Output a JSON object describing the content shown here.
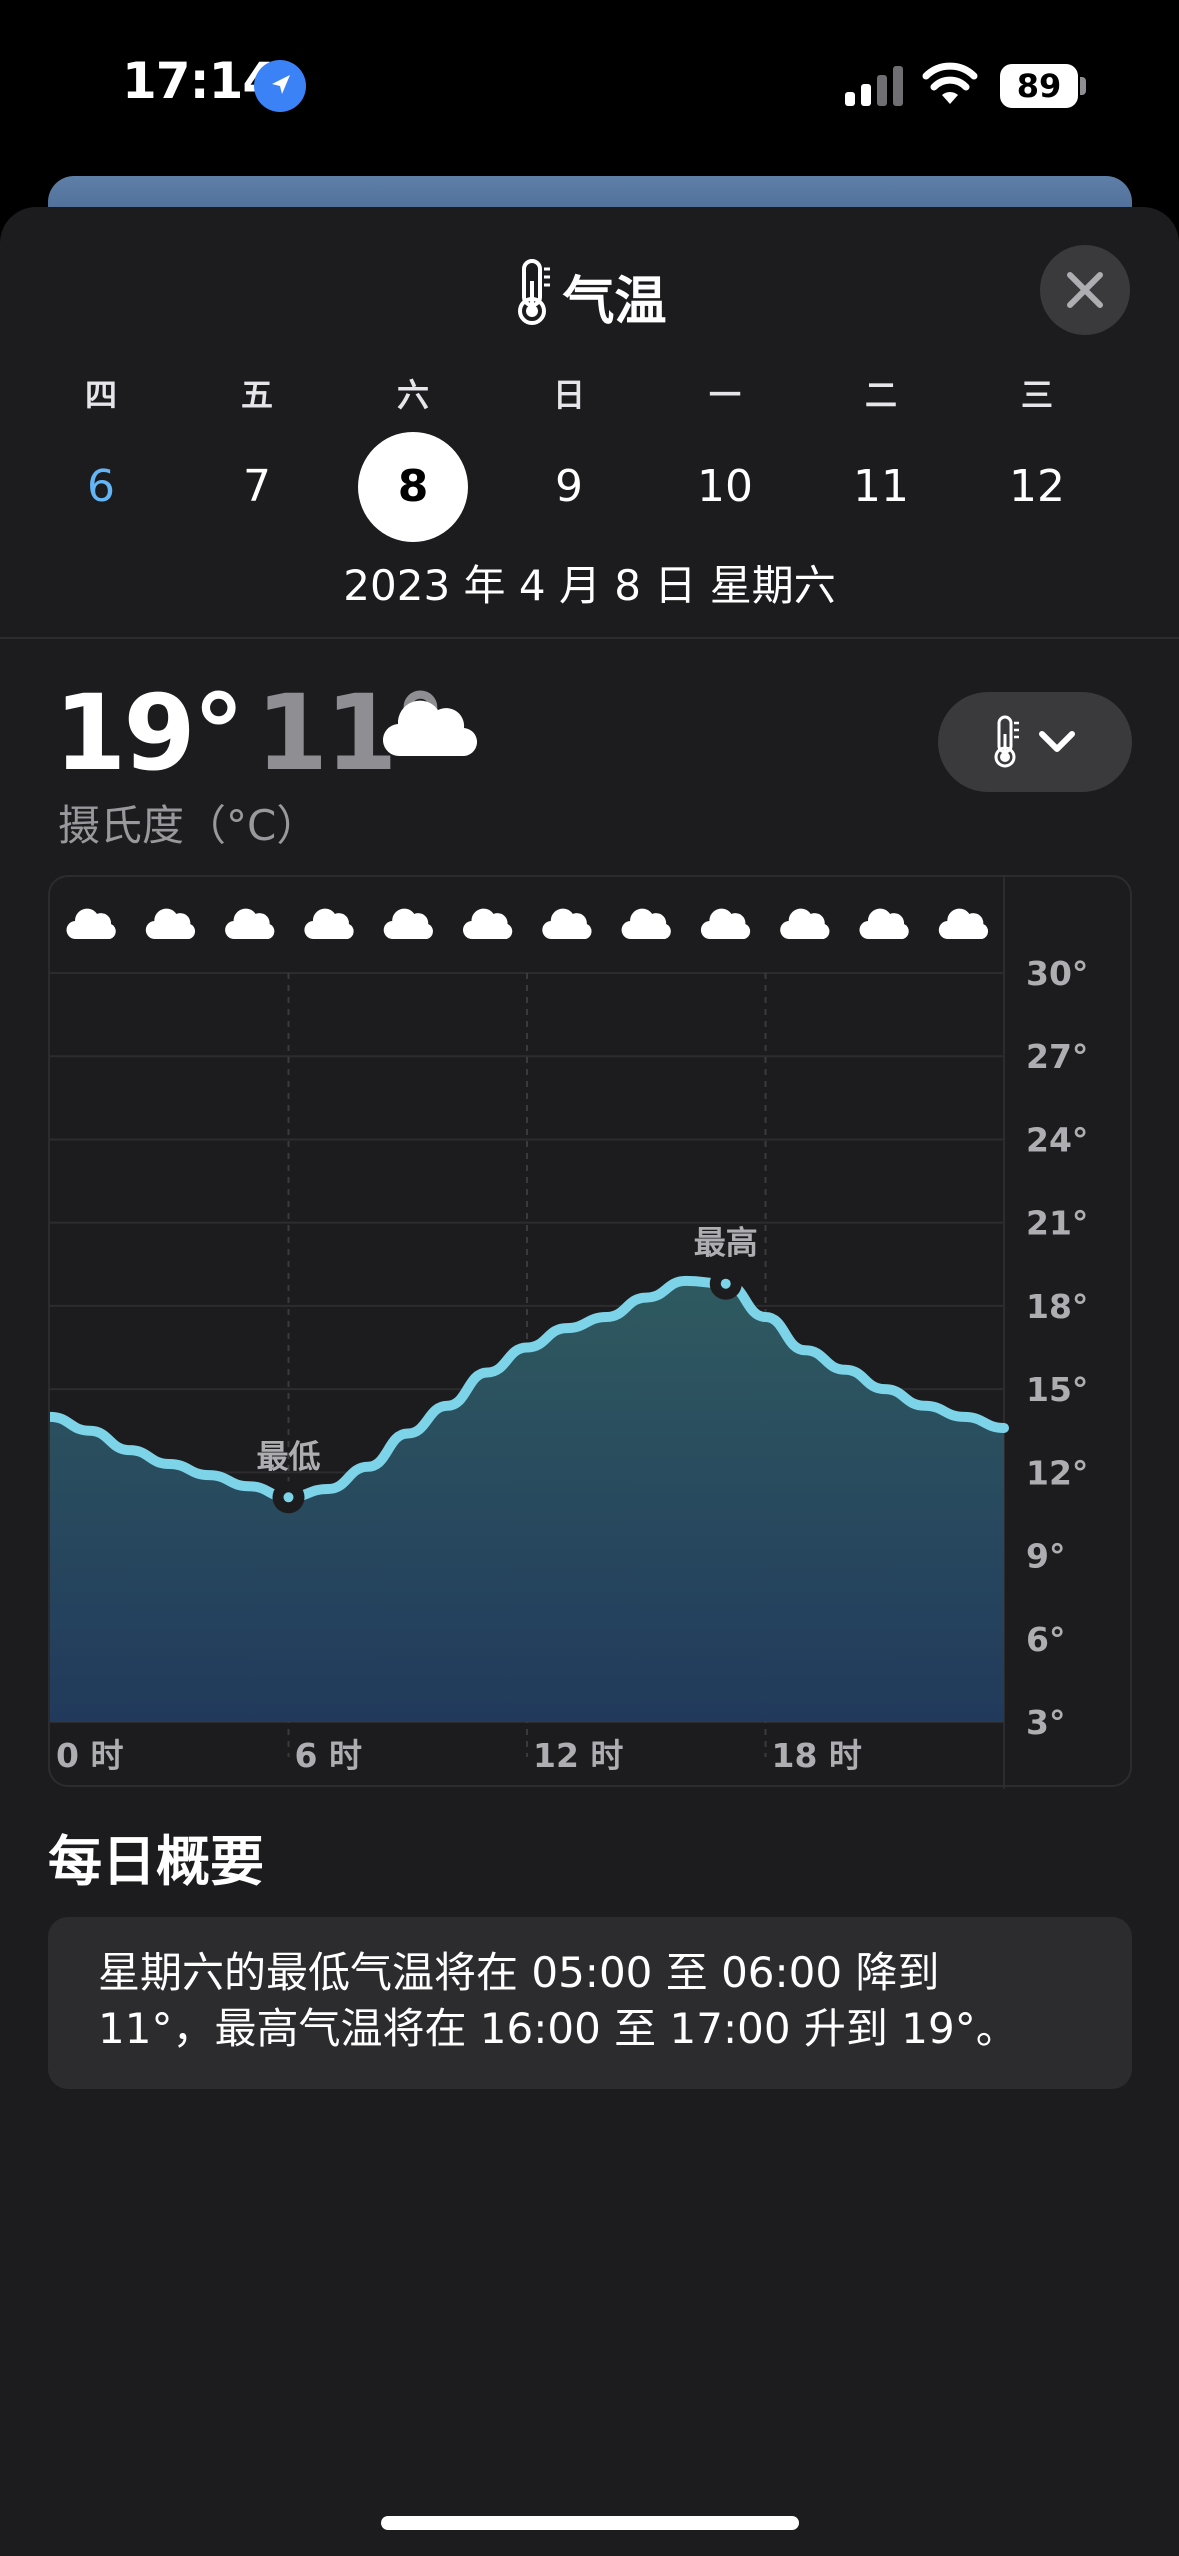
{
  "status_bar": {
    "time": "17:14",
    "battery": "89"
  },
  "sheet": {
    "title": "气温",
    "weekdays": [
      "四",
      "五",
      "六",
      "日",
      "一",
      "二",
      "三"
    ],
    "dates": [
      "6",
      "7",
      "8",
      "9",
      "10",
      "11",
      "12"
    ],
    "selected_date": "8",
    "today_date": "6",
    "full_date": "2023 年 4 月 8 日 星期六"
  },
  "current": {
    "high": "19°",
    "low": "11°",
    "unit_label": "摄氏度（°C）",
    "condition_icon": "cloud-icon"
  },
  "chart_data": {
    "type": "area",
    "x_tick_labels": [
      "0 时",
      "6 时",
      "12 时",
      "18 时"
    ],
    "y_tick_labels": [
      "30°",
      "27°",
      "24°",
      "21°",
      "18°",
      "15°",
      "12°",
      "9°",
      "6°",
      "3°"
    ],
    "ylim": [
      3,
      30
    ],
    "xlim": [
      0,
      24
    ],
    "hourly_icons": [
      "cloud-icon",
      "cloud-icon",
      "cloud-icon",
      "cloud-icon",
      "cloud-icon",
      "cloud-icon",
      "cloud-icon",
      "cloud-icon",
      "cloud-icon",
      "cloud-icon",
      "cloud-icon",
      "cloud-icon"
    ],
    "series": [
      {
        "x": [
          0,
          1,
          2,
          3,
          4,
          5,
          6,
          7,
          8,
          9,
          10,
          11,
          12,
          13,
          14,
          15,
          16,
          17,
          18,
          19,
          20,
          21,
          22,
          23,
          24
        ],
        "values": [
          14,
          13.5,
          12.8,
          12.3,
          11.9,
          11.5,
          11.1,
          11.4,
          12.2,
          13.4,
          14.4,
          15.6,
          16.5,
          17.2,
          17.6,
          18.3,
          18.9,
          18.8,
          17.6,
          16.4,
          15.7,
          15,
          14.4,
          14,
          13.6
        ]
      }
    ],
    "annotations": [
      {
        "label": "最低",
        "x": 6,
        "y": 11
      },
      {
        "label": "最高",
        "x": 17,
        "y": 19
      }
    ],
    "grid": true,
    "colors": {
      "line": "#7dd3e8",
      "fill_top": "#2f5a60",
      "fill_bottom": "#213a5c"
    }
  },
  "summary": {
    "title": "每日概要",
    "text_line1": "星期六的最低气温将在 05:00 至 06:00 降到",
    "text_line2": "11°，最高气温将在 16:00 至 17:00 升到 19°。"
  }
}
